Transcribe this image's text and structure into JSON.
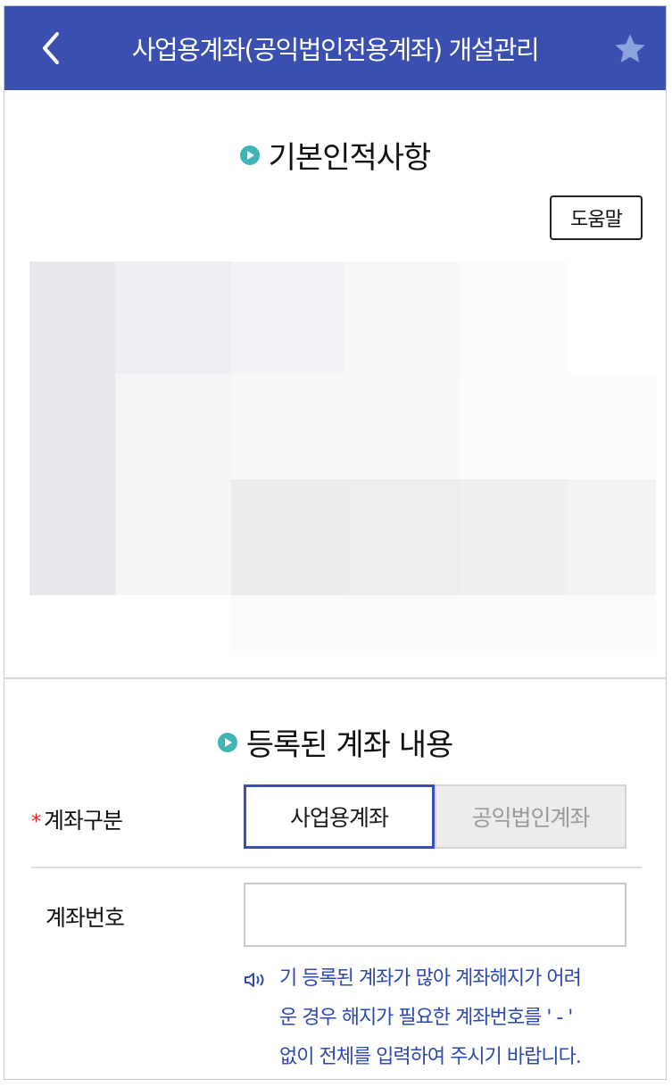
{
  "header": {
    "title": "사업용계좌(공익법인전용계좌) 개설관리",
    "back_icon": "chevron-left-icon",
    "favorite_icon": "star-icon",
    "background_color": "#3b4fb0"
  },
  "basic_info": {
    "title": "기본인적사항",
    "help_label": "도움말"
  },
  "registered_account": {
    "title": "등록된 계좌 내용",
    "account_type": {
      "label": "계좌구분",
      "required_mark": "*",
      "options": [
        "사업용계좌",
        "공익법인계좌"
      ],
      "selected": "사업용계좌"
    },
    "account_number": {
      "label": "계좌번호",
      "value": "",
      "placeholder": ""
    },
    "notice_lines": [
      "기 등록된 계좌가 많아 계좌해지가 어려",
      "운 경우 해지가 필요한 계좌번호를 ' - '",
      "없이 전체를 입력하여 주시기 바랍니다."
    ],
    "notice_color": "#2b49b3"
  }
}
